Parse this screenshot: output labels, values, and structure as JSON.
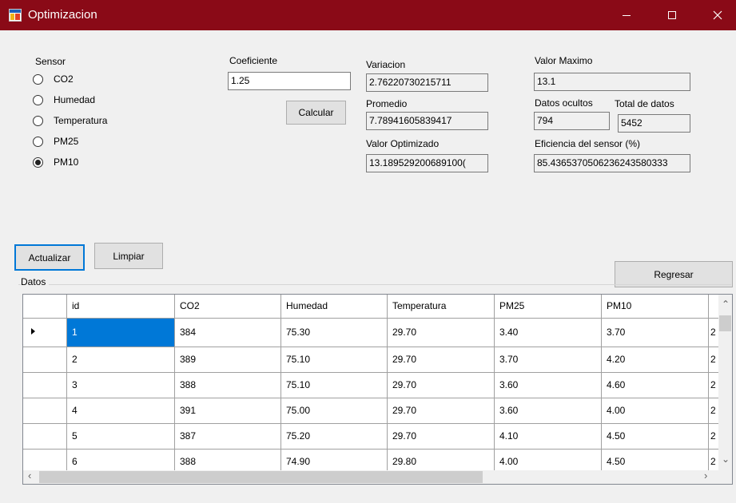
{
  "window": {
    "title": "Optimizacion",
    "accent": "#8a0a17",
    "controls": [
      "minimize-icon",
      "maximize-icon",
      "close-icon"
    ]
  },
  "sensor": {
    "label": "Sensor",
    "options": [
      {
        "label": "CO2",
        "checked": false
      },
      {
        "label": "Humedad",
        "checked": false
      },
      {
        "label": "Temperatura",
        "checked": false
      },
      {
        "label": "PM25",
        "checked": false
      },
      {
        "label": "PM10",
        "checked": true
      }
    ]
  },
  "coeficiente": {
    "label": "Coeficiente",
    "value": "1.25"
  },
  "buttons": {
    "calcular": "Calcular",
    "actualizar": "Actualizar",
    "limpiar": "Limpiar",
    "regresar": "Regresar"
  },
  "stats": {
    "variacion": {
      "label": "Variacion",
      "value": "2.76220730215711"
    },
    "promedio": {
      "label": "Promedio",
      "value": "7.78941605839417"
    },
    "valor_optimizado": {
      "label": "Valor Optimizado",
      "value": "13.189529200689100("
    },
    "valor_maximo": {
      "label": "Valor Maximo",
      "value": "13.1"
    },
    "datos_ocultos": {
      "label": "Datos ocultos",
      "value": "794"
    },
    "total_datos": {
      "label": "Total de datos",
      "value": "5452"
    },
    "eficiencia": {
      "label": "Eficiencia del sensor (%)",
      "value": "85.4365370506236243580333"
    }
  },
  "datos": {
    "label": "Datos",
    "columns": [
      "id",
      "CO2",
      "Humedad",
      "Temperatura",
      "PM25",
      "PM10"
    ],
    "rows": [
      [
        "1",
        "384",
        "75.30",
        "29.70",
        "3.40",
        "3.70"
      ],
      [
        "2",
        "389",
        "75.10",
        "29.70",
        "3.70",
        "4.20"
      ],
      [
        "3",
        "388",
        "75.10",
        "29.70",
        "3.60",
        "4.60"
      ],
      [
        "4",
        "391",
        "75.00",
        "29.70",
        "3.60",
        "4.00"
      ],
      [
        "5",
        "387",
        "75.20",
        "29.70",
        "4.10",
        "4.50"
      ],
      [
        "6",
        "388",
        "74.90",
        "29.80",
        "4.00",
        "4.50"
      ]
    ],
    "cut_column_char": "2",
    "selection_color": "#0078d7"
  }
}
